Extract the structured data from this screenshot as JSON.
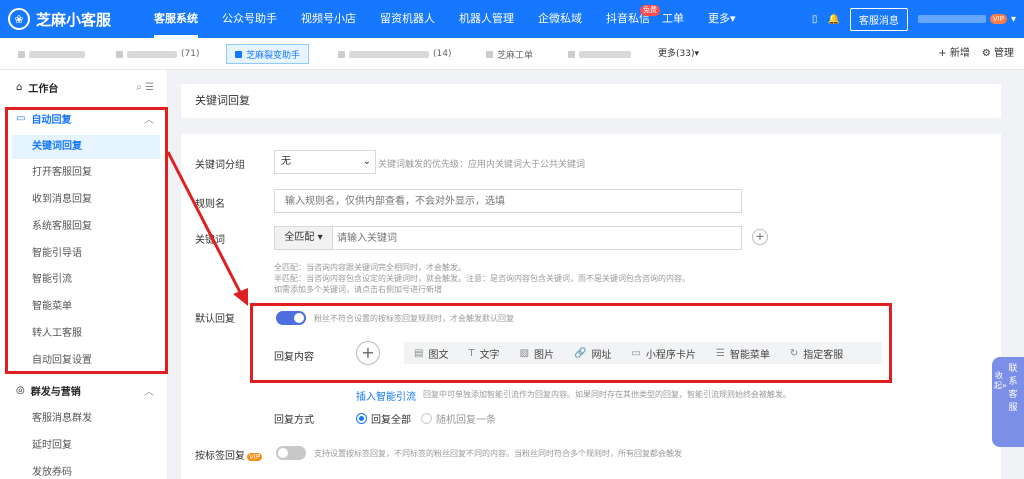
{
  "app": {
    "logo_glyph": "❀",
    "name": "芝麻小客服"
  },
  "nav": {
    "items": [
      {
        "label": "客服系统",
        "active": true
      },
      {
        "label": "公众号助手"
      },
      {
        "label": "视频号小店"
      },
      {
        "label": "留资机器人"
      },
      {
        "label": "机器人管理"
      },
      {
        "label": "企微私域"
      },
      {
        "label": "抖音私信",
        "badge": "免费"
      },
      {
        "label": "工单"
      },
      {
        "label": "更多▾"
      }
    ],
    "phone_icon": "▯",
    "bell_icon": "🔔",
    "service_msg": "客服消息",
    "vip": "VIP",
    "account_menu": "▾"
  },
  "tabs": {
    "items": [
      {
        "label": "芝麻裂变助手",
        "active": true
      },
      {
        "label": "(71)"
      },
      {
        "label": "(14)"
      },
      {
        "label": "芝麻工单"
      }
    ],
    "more": "更多(33)▾",
    "add": "+ 新增",
    "manage": "⚙ 管理"
  },
  "sidebar": {
    "workbench": "工作台",
    "auto_reply": "自动回复",
    "auto_items": [
      "关键词回复",
      "打开客服回复",
      "收到消息回复",
      "系统客服回复",
      "智能引导语",
      "智能引流",
      "智能菜单",
      "转人工客服",
      "自动回复设置"
    ],
    "group": "群发与营销",
    "group_items": [
      "客服消息群发",
      "延时回复",
      "发放券码"
    ]
  },
  "main": {
    "title": "关键词回复",
    "kw_group_label": "关键词分组",
    "kw_group_value": "无",
    "kw_group_hint": "关键词触发的优先级：应用内关键词大于公共关键词",
    "rule_name_label": "规则名",
    "rule_name_placeholder": "输入规则名，仅供内部查看，不会对外显示，选填",
    "keyword_label": "关键词",
    "match_mode": "全匹配 ▾",
    "keyword_placeholder": "请输入关键词",
    "hint1": "全匹配：当咨询内容跟关键词完全相同时，才会触发。",
    "hint2": "半匹配：当咨询内容包含设定的关键词时，就会触发。注意：是咨询内容包含关键词，而不是关键词包含咨询的内容。",
    "hint3": "如需添加多个关键词，请点击右侧加号进行新增",
    "default_reply_label": "默认回复",
    "default_reply_hint": "粉丝不符合设置的按标签回复规则时，才会触发默认回复",
    "reply_content_label": "回复内容",
    "content_types": [
      {
        "icon": "▤",
        "label": "图文"
      },
      {
        "icon": "T",
        "label": "文字"
      },
      {
        "icon": "▨",
        "label": "图片"
      },
      {
        "icon": "🔗",
        "label": "网址"
      },
      {
        "icon": "▭",
        "label": "小程序卡片"
      },
      {
        "icon": "☰",
        "label": "智能菜单"
      },
      {
        "icon": "↻",
        "label": "指定客服"
      }
    ],
    "insert_link": "插入智能引流",
    "insert_hint": "回复中可单独添加智能引流作为回复内容。如果同时存在其他类型的回复，智能引流规则始终会被触发。",
    "reply_mode_label": "回复方式",
    "reply_all": "回复全部",
    "reply_random": "随机回复一条",
    "tag_reply_label": "按标签回复",
    "tag_reply_vip": "VIP",
    "tag_reply_hint": "支持设置按标签回复，不同标签的粉丝回复不同的内容。当粉丝同时符合多个规则时，所有回复都会触发"
  },
  "float_btn": {
    "fold": "收起»",
    "contact": "联系客服"
  },
  "colors": {
    "primary": "#1677ff",
    "annotation": "#e02020"
  }
}
